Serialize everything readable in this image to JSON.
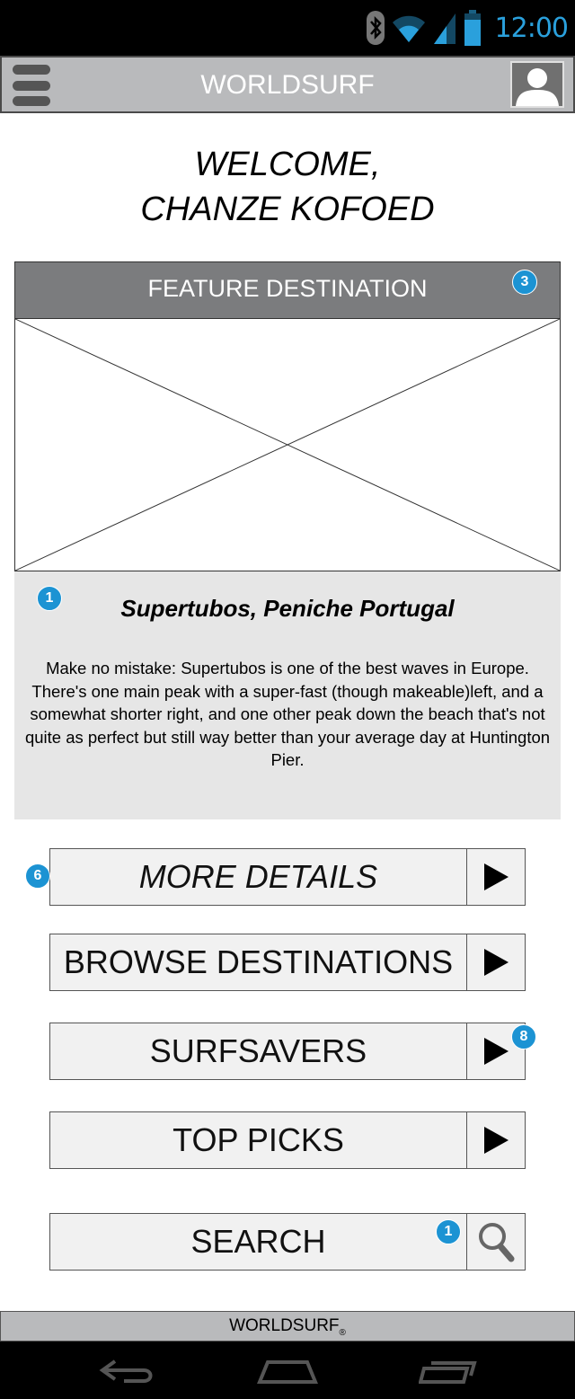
{
  "status_bar": {
    "time": "12:00",
    "icons": [
      "bluetooth-icon",
      "wifi-icon",
      "signal-icon",
      "battery-icon"
    ]
  },
  "app_bar": {
    "title": "WORLDSURF",
    "menu_icon": "hamburger-menu-icon",
    "profile_icon": "user-avatar-icon"
  },
  "welcome": {
    "line1": "WELCOME,",
    "line2": "CHANZE KOFOED"
  },
  "feature": {
    "header": "FEATURE DESTINATION",
    "header_badge": "3",
    "image_placeholder": "image-placeholder",
    "badge": "1",
    "title": "Supertubos, Peniche Portugal",
    "description": "Make no mistake: Supertubos is one of the best waves in Europe. There's one main peak with a super-fast (though makeable)left, and a somewhat shorter right, and one other peak down the beach that's not quite as perfect but still way better than your average day at Huntington Pier."
  },
  "menu": [
    {
      "label": "MORE DETAILS",
      "icon": "play-arrow-icon",
      "badge": "6"
    },
    {
      "label": "BROWSE DESTINATIONS",
      "icon": "play-arrow-icon"
    },
    {
      "label": "SURFSAVERS",
      "icon": "play-arrow-icon",
      "badge": "8"
    },
    {
      "label": "TOP PICKS",
      "icon": "play-arrow-icon"
    },
    {
      "label": "SEARCH",
      "icon": "search-icon",
      "badge": "1"
    }
  ],
  "footer": {
    "brand": "WORLDSURF",
    "mark": "®"
  },
  "nav_bar": {
    "icons": [
      "back-icon",
      "home-icon",
      "recent-apps-icon"
    ]
  },
  "colors": {
    "accent_blue": "#1c93d3",
    "app_bar": "#b9babc",
    "feature_header": "#7b7c7e",
    "feature_body": "#e6e6e6"
  }
}
